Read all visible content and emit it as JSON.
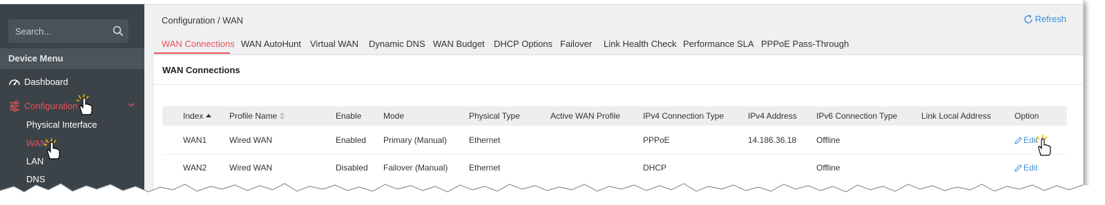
{
  "sidebar": {
    "search_placeholder": "Search...",
    "menu_header": "Device Menu",
    "items": [
      {
        "label": "Dashboard",
        "icon": "dashboard-icon"
      },
      {
        "label": "Configuration",
        "icon": "sliders-icon"
      }
    ],
    "sub_items": [
      "Physical Interface",
      "WAN",
      "LAN",
      "DNS"
    ]
  },
  "header": {
    "breadcrumb": "Configuration / WAN",
    "refresh_label": "Refresh"
  },
  "tabs": [
    "WAN Connections",
    "WAN AutoHunt",
    "Virtual WAN",
    "Dynamic DNS",
    "WAN Budget",
    "DHCP Options",
    "Failover",
    "Link Health Check",
    "Performance SLA",
    "PPPoE Pass-Through"
  ],
  "card": {
    "title": "WAN Connections"
  },
  "table": {
    "columns": [
      "Index",
      "Profile Name",
      "Enable",
      "Mode",
      "Physical Type",
      "Active WAN Profile",
      "IPv4 Connection Type",
      "IPv4 Address",
      "IPv6 Connection Type",
      "Link Local Address",
      "Option"
    ],
    "rows": [
      {
        "index": "WAN1",
        "profile": "Wired WAN",
        "enable": "Enabled",
        "mode": "Primary (Manual)",
        "phys": "Ethernet",
        "active": "",
        "ipv4type": "PPPoE",
        "ipv4addr": "14.186.36.18",
        "ipv6type": "Offline",
        "linklocal": "",
        "option": "Edit"
      },
      {
        "index": "WAN2",
        "profile": "Wired WAN",
        "enable": "Disabled",
        "mode": "Failover (Manual)",
        "phys": "Ethernet",
        "active": "",
        "ipv4type": "DHCP",
        "ipv4addr": "",
        "ipv6type": "Offline",
        "linklocal": "",
        "option": "Edit"
      }
    ]
  },
  "colors": {
    "accent": "#e8505b",
    "link": "#3c8fd8",
    "sidebar_bg": "#3b4248"
  }
}
